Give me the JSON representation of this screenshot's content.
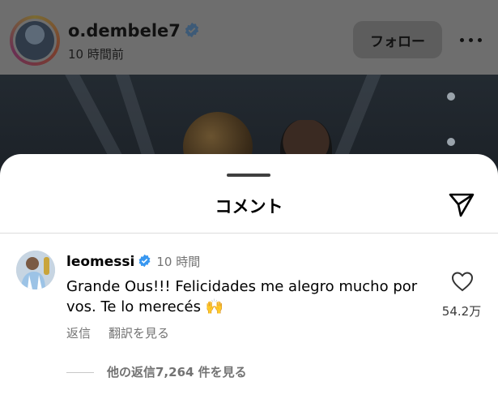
{
  "post": {
    "username": "o.dembele7",
    "time": "10 時間前",
    "follow_label": "フォロー"
  },
  "sheet": {
    "title": "コメント"
  },
  "comment": {
    "username": "leomessi",
    "time": "10 時間",
    "text": "Grande Ous!!! Felicidades me alegro mucho por vos. Te lo merecés 🙌",
    "reply_label": "返信",
    "translate_label": "翻訳を見る",
    "like_count": "54.2万",
    "more_replies": "他の返信7,264 件を見る"
  },
  "colors": {
    "verified": "#3897f0",
    "overlay": "#6e6e6e"
  }
}
